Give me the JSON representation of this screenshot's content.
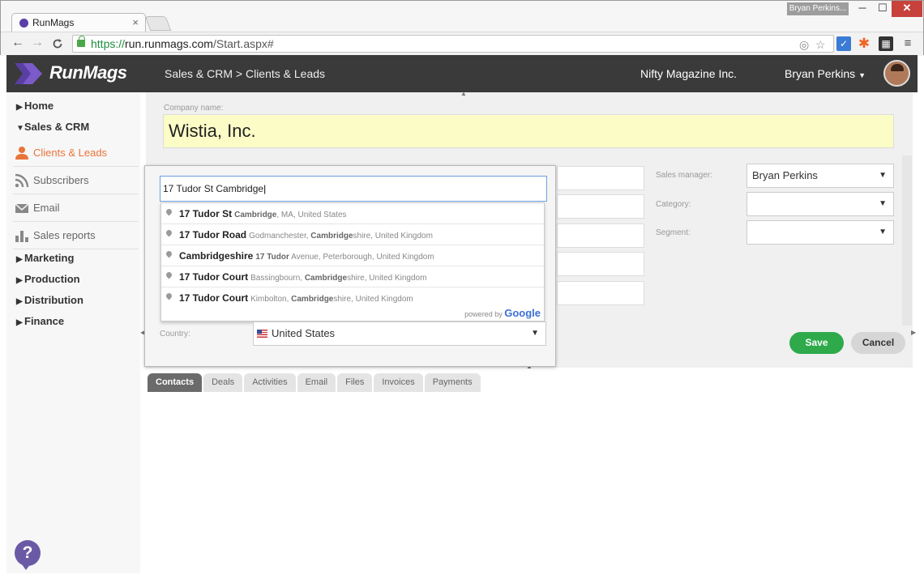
{
  "browser": {
    "tab_title": "RunMags",
    "tab_close": "×",
    "profile_name": "Bryan Perkins...",
    "url_protocol": "https://",
    "url_host": "run.runmags.com",
    "url_path": "/Start.aspx#",
    "win_min": "─",
    "win_max": "☐",
    "win_close": "✕",
    "back": "←",
    "forward": "→",
    "reload": "C"
  },
  "header": {
    "logo_text": "RunMags",
    "breadcrumb": "Sales & CRM > Clients & Leads",
    "organization": "Nifty Magazine Inc.",
    "user_name": "Bryan Perkins",
    "brand_color": "#6b4fbb"
  },
  "sidebar": {
    "top_items": [
      {
        "label": "Home",
        "expanded": false
      },
      {
        "label": "Sales & CRM",
        "expanded": true
      },
      {
        "label": "Marketing",
        "expanded": false
      },
      {
        "label": "Production",
        "expanded": false
      },
      {
        "label": "Distribution",
        "expanded": false
      },
      {
        "label": "Finance",
        "expanded": false
      }
    ],
    "sub_items": [
      {
        "label": "Clients & Leads",
        "icon": "person-icon",
        "active": true
      },
      {
        "label": "Subscribers",
        "icon": "rss-icon",
        "active": false
      },
      {
        "label": "Email",
        "icon": "envelope-icon",
        "active": false
      },
      {
        "label": "Sales reports",
        "icon": "bar-chart-icon",
        "active": false
      }
    ],
    "help": "?"
  },
  "form": {
    "company_label": "Company name:",
    "company_value": "Wistia, Inc.",
    "sales_manager_label": "Sales manager:",
    "sales_manager_value": "Bryan Perkins",
    "category_label": "Category:",
    "category_value": "",
    "segment_label": "Segment:",
    "segment_value": "",
    "country_label": "Country:",
    "country_value": "United States",
    "save_label": "Save",
    "cancel_label": "Cancel"
  },
  "address_lookup": {
    "query": "17 Tudor St Cambridge",
    "suggestions": [
      {
        "main": "17 Tudor St",
        "secondary": "Cambridge, MA, United States"
      },
      {
        "main": "17 Tudor Road",
        "secondary": "Godmanchester, Cambridgeshire, United Kingdom"
      },
      {
        "main": "Cambridgeshire",
        "secondary": "17 Tudor Avenue, Peterborough, United Kingdom"
      },
      {
        "main": "17 Tudor Court",
        "secondary": "Bassingbourn, Cambridgeshire, United Kingdom"
      },
      {
        "main": "17 Tudor Court",
        "secondary": "Kimbolton, Cambridgeshire, United Kingdom"
      }
    ],
    "powered_by": "powered by",
    "provider": "Google"
  },
  "tabs": [
    "Contacts",
    "Deals",
    "Activities",
    "Email",
    "Files",
    "Invoices",
    "Payments"
  ],
  "active_tab": "Contacts",
  "colors": {
    "accent_orange": "#e8753a",
    "save_green": "#2eaa4a",
    "company_highlight": "#fbfcc6"
  }
}
